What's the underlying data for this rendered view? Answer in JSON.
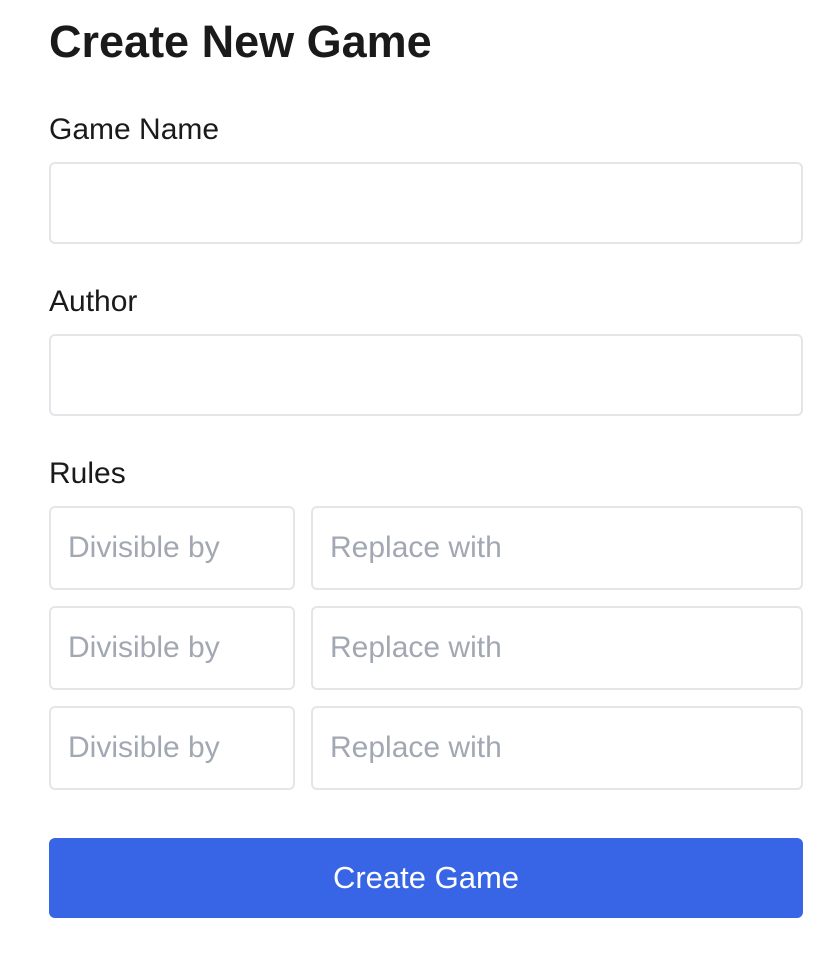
{
  "page_title": "Create New Game",
  "fields": {
    "game_name": {
      "label": "Game Name",
      "value": "",
      "placeholder": ""
    },
    "author": {
      "label": "Author",
      "value": "",
      "placeholder": ""
    }
  },
  "rules": {
    "label": "Rules",
    "items": [
      {
        "divisor_placeholder": "Divisible by",
        "replacement_placeholder": "Replace with"
      },
      {
        "divisor_placeholder": "Divisible by",
        "replacement_placeholder": "Replace with"
      },
      {
        "divisor_placeholder": "Divisible by",
        "replacement_placeholder": "Replace with"
      }
    ]
  },
  "submit": {
    "label": "Create Game"
  },
  "colors": {
    "accent": "#3765e5",
    "border": "#e3e5e8",
    "placeholder": "#a2a8b3",
    "text": "#1a1a1a"
  }
}
